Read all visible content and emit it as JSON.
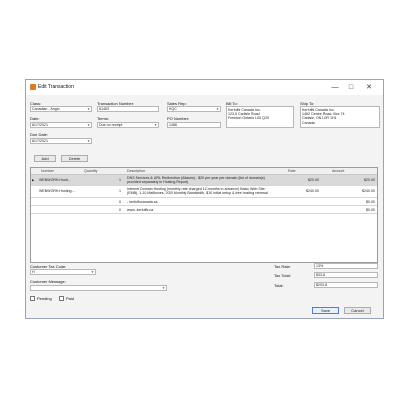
{
  "window": {
    "title": "Edit Transaction"
  },
  "window_controls": {
    "minimize": "—",
    "maximize": "□",
    "close": "✕"
  },
  "header": {
    "class_label": "Class:",
    "class_value": "Canadian - Anglo",
    "transaction_number_label": "Transaction Number:",
    "transaction_number_value": "61463",
    "sales_rep_label": "Sales Rep:",
    "sales_rep_value": "KQC",
    "bill_to_label": "Bill To:",
    "bill_to_value": "Kerfuffs Canada Inc.\n123,5 Carlisle Road\nFreedon Ontario L00 Q29",
    "ship_to_label": "Ship To:",
    "ship_to_value": "Kerfuffs Canada Inc.\n1462 Centre Road, Box 74\nCarlisle, ON L0R 1H1\nCanada",
    "date_label": "Date:",
    "date_value": "8/17/2021",
    "terms_label": "Terms:",
    "terms_value": "Due on receipt",
    "po_number_label": "PO Number:",
    "po_number_value": "1486",
    "due_date_label": "Due Date:",
    "due_date_value": "8/17/2021"
  },
  "actions": {
    "add_label": "Add",
    "delete_label": "Delete"
  },
  "table": {
    "columns": [
      "Number",
      "Quantity",
      "Description",
      "Rate",
      "Amount"
    ],
    "rows": [
      {
        "number": "WEBWORK:Hosti...",
        "quantity": "1",
        "description": "DNS Services & URL Redirection (Aliases) - $20 per year per domain (list of domain(s)\nprovided separately in Hosting Report)",
        "rate": "$20.00",
        "amount": "$20.00"
      },
      {
        "number": "WEBWORK:Hosting:...",
        "quantity": "1",
        "description": "Internet Domain Hosting (monthly rate charged 12-months in advance) Basic Web Site:\n(EMB), 1-10 Mailboxes, 2GB Monthly Bandwidth, $10 initial setup & free hosting renewal",
        "rate": "$240.00",
        "amount": "$240.00"
      },
      {
        "number": "",
        "quantity": "0",
        "description": "- kerfuffscanada.ca",
        "rate": "",
        "amount": "$0.00"
      },
      {
        "number": "",
        "quantity": "0",
        "description": "www. kerfuffs.ca",
        "rate": "",
        "amount": "$0.00"
      }
    ]
  },
  "footer": {
    "customer_tax_code_label": "Customer Tax Code:",
    "customer_tax_code_value": "H",
    "customer_message_label": "Customer Message:",
    "customer_message_value": "",
    "tax_rate_label": "Tax Rate:",
    "tax_rate_value": "13%",
    "tax_total_label": "Tax Total:",
    "tax_total_value": "$33.8",
    "total_label": "Total:",
    "total_value": "$293.8",
    "pending_label": "Pending",
    "paid_label": "Paid",
    "save_label": "Save",
    "cancel_label": "Cancel"
  },
  "colors": {
    "accent": "#4a7fd4",
    "selected_row": "#d9d9d9"
  }
}
